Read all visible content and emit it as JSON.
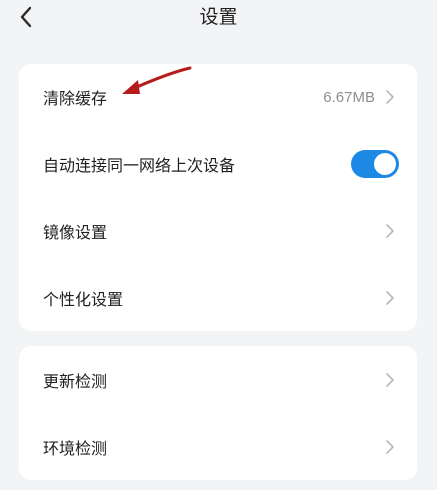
{
  "header": {
    "title": "设置",
    "back_icon": "chevron-left-icon"
  },
  "group1": [
    {
      "label": "清除缓存",
      "value": "6.67MB",
      "type": "link"
    },
    {
      "label": "自动连接同一网络上次设备",
      "type": "toggle",
      "toggle_on": true
    },
    {
      "label": "镜像设置",
      "type": "link"
    },
    {
      "label": "个性化设置",
      "type": "link"
    }
  ],
  "group2": [
    {
      "label": "更新检测",
      "type": "link"
    },
    {
      "label": "环境检测",
      "type": "link"
    }
  ],
  "colors": {
    "background": "#f3f4f6",
    "card": "#ffffff",
    "accent": "#1e88e5",
    "annotation": "#b71c1c"
  }
}
